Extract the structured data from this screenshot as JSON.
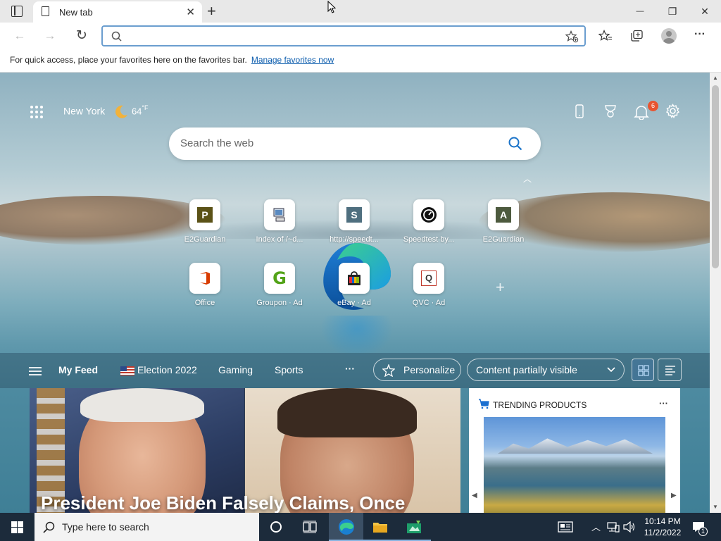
{
  "browser": {
    "tab_title": "New tab",
    "tab_close": "✕",
    "new_tab": "+",
    "minimize": "—",
    "restore": "❐",
    "close": "✕",
    "back": "←",
    "forward": "→",
    "refresh": "↻",
    "address_value": "",
    "favorites_bar_text": "For quick access, place your favorites here on the favorites bar.",
    "favorites_link": "Manage favorites now"
  },
  "newtab": {
    "weather_city": "New York",
    "weather_temp": "64",
    "weather_unit": "°F",
    "notification_count": "6",
    "search_placeholder": "Search the web",
    "tiles_row1": [
      {
        "label": "E2Guardian",
        "glyph": "P",
        "color": "#5b5217"
      },
      {
        "label": "Index of /~d...",
        "glyph": "🖥",
        "color": "#333"
      },
      {
        "label": "http://speedt...",
        "glyph": "S",
        "color": "#4f6f7f"
      },
      {
        "label": "Speedtest by...",
        "glyph": "◔",
        "color": "#111"
      },
      {
        "label": "E2Guardian",
        "glyph": "A",
        "color": "#4d5a3e"
      }
    ],
    "tiles_row2": [
      {
        "label": "Office",
        "glyph": "O",
        "color": "#d83b01"
      },
      {
        "label": "Groupon · Ad",
        "glyph": "G",
        "color": "#53a318"
      },
      {
        "label": "eBay · Ad",
        "glyph": "🛍",
        "color": "#333"
      },
      {
        "label": "QVC · Ad",
        "glyph": "Q",
        "color": "#c0392b"
      }
    ],
    "add_tile": "+"
  },
  "feed": {
    "my_feed": "My Feed",
    "election": "Election 2022",
    "gaming": "Gaming",
    "sports": "Sports",
    "more": "···",
    "personalize": "Personalize",
    "content_visibility": "Content partially visible",
    "headline": "President Joe Biden Falsely Claims, Once",
    "trending_title": "TRENDING PRODUCTS",
    "trending_more": "···"
  },
  "taskbar": {
    "search_placeholder": "Type here to search",
    "time": "10:14 PM",
    "date": "11/2/2022",
    "notif_count": "1"
  }
}
